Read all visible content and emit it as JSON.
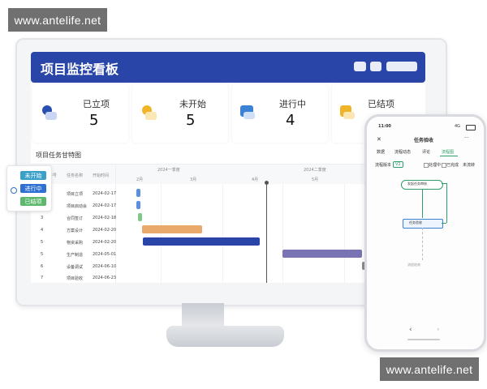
{
  "watermark": {
    "text": "www.antelife.net"
  },
  "dashboard": {
    "title": "项目监控看板",
    "cards": [
      {
        "label": "已立项",
        "value": "5",
        "icon": "document-icon",
        "color": "#2a4fb0"
      },
      {
        "label": "未开始",
        "value": "5",
        "icon": "clock-icon",
        "color": "#f0b429"
      },
      {
        "label": "进行中",
        "value": "4",
        "icon": "chart-icon",
        "color": "#3b82d6"
      },
      {
        "label": "已结项",
        "value": "",
        "icon": "folder-icon",
        "color": "#f0b429"
      }
    ],
    "gantt_title": "项目任务甘特图",
    "gantt_headers": [
      "序号",
      "任务名称",
      "开始时间"
    ],
    "periods": [
      "2024一季度",
      "2024二季度"
    ],
    "months": [
      "2月",
      "3月",
      "4月",
      "5月"
    ],
    "rows": [
      {
        "num": "1",
        "name": "项目立项",
        "start": "2024-02-17"
      },
      {
        "num": "2",
        "name": "项目启动会",
        "start": "2024-02-17"
      },
      {
        "num": "3",
        "name": "合同签订",
        "start": "2024-02-18"
      },
      {
        "num": "4",
        "name": "方案设计",
        "start": "2024-02-20"
      },
      {
        "num": "5",
        "name": "物资采购",
        "start": "2024-02-20"
      },
      {
        "num": "5",
        "name": "生产制造",
        "start": "2024-05-01"
      },
      {
        "num": "6",
        "name": "设备调试",
        "start": "2024-06-10"
      },
      {
        "num": "7",
        "name": "项目验收",
        "start": "2024-06-23"
      }
    ]
  },
  "legend": {
    "items": [
      {
        "label": "未开始",
        "color": "#3aa0c9"
      },
      {
        "label": "进行中",
        "color": "#2f6fd1"
      },
      {
        "label": "已结项",
        "color": "#5bb86c"
      }
    ]
  },
  "phone": {
    "time": "11:00",
    "status": "4G",
    "nav_title": "任务验收",
    "close": "✕",
    "more": "···",
    "tabs": [
      "数据",
      "流程动态",
      "评论",
      "流程图"
    ],
    "active_tab": "流程图",
    "flow_label": "流程版本",
    "flow_version": "V2",
    "filters": [
      "处理中",
      "已完成",
      "未流转"
    ],
    "nodes": [
      "发起任务审核",
      "任务验收",
      "流程结束"
    ],
    "back": "‹",
    "forward": "›"
  }
}
